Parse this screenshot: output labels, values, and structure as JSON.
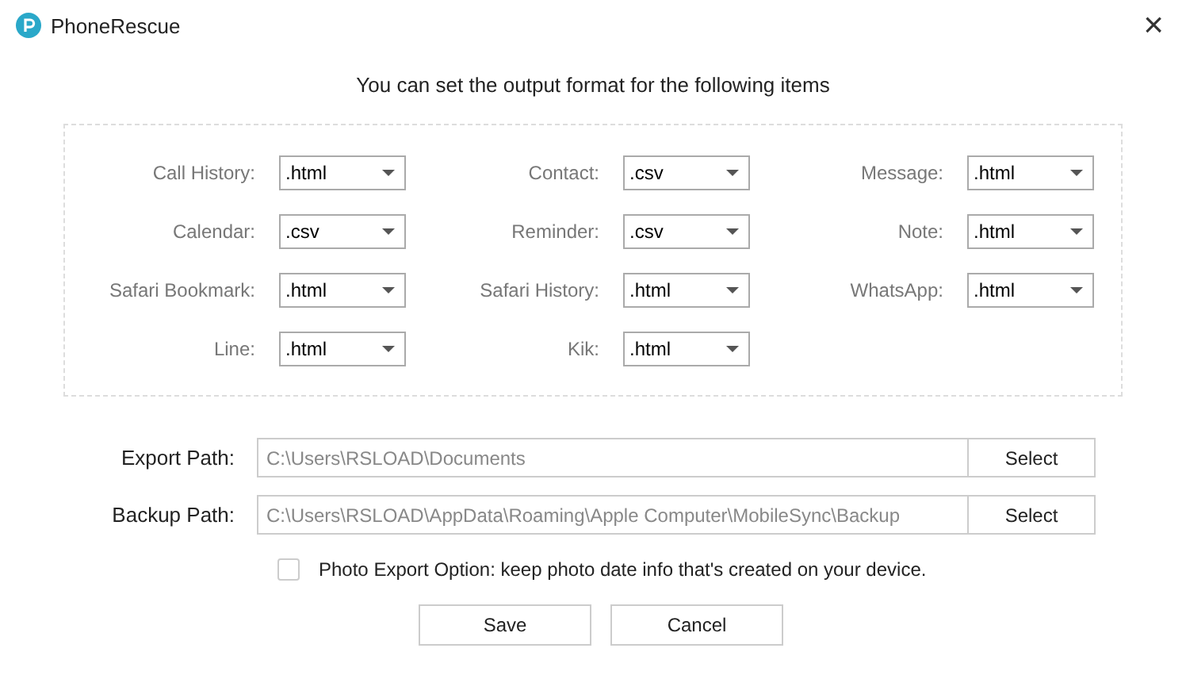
{
  "window": {
    "title": "PhoneRescue",
    "close": "×"
  },
  "heading": "You can set the output format for the following items",
  "formats": [
    {
      "label": "Call History:",
      "value": ".html"
    },
    {
      "label": "Contact:",
      "value": ".csv"
    },
    {
      "label": "Message:",
      "value": ".html"
    },
    {
      "label": "Calendar:",
      "value": ".csv"
    },
    {
      "label": "Reminder:",
      "value": ".csv"
    },
    {
      "label": "Note:",
      "value": ".html"
    },
    {
      "label": "Safari Bookmark:",
      "value": ".html"
    },
    {
      "label": "Safari History:",
      "value": ".html"
    },
    {
      "label": "WhatsApp:",
      "value": ".html"
    },
    {
      "label": "Line:",
      "value": ".html"
    },
    {
      "label": "Kik:",
      "value": ".html"
    }
  ],
  "paths": [
    {
      "label": "Export Path:",
      "value": "C:\\Users\\RSLOAD\\Documents",
      "button": "Select"
    },
    {
      "label": "Backup Path:",
      "value": "C:\\Users\\RSLOAD\\AppData\\Roaming\\Apple Computer\\MobileSync\\Backup",
      "button": "Select"
    }
  ],
  "photo_option": {
    "label": "Photo Export Option: keep photo date info that's created on your device.",
    "checked": false
  },
  "buttons": [
    "Save",
    "Cancel"
  ]
}
